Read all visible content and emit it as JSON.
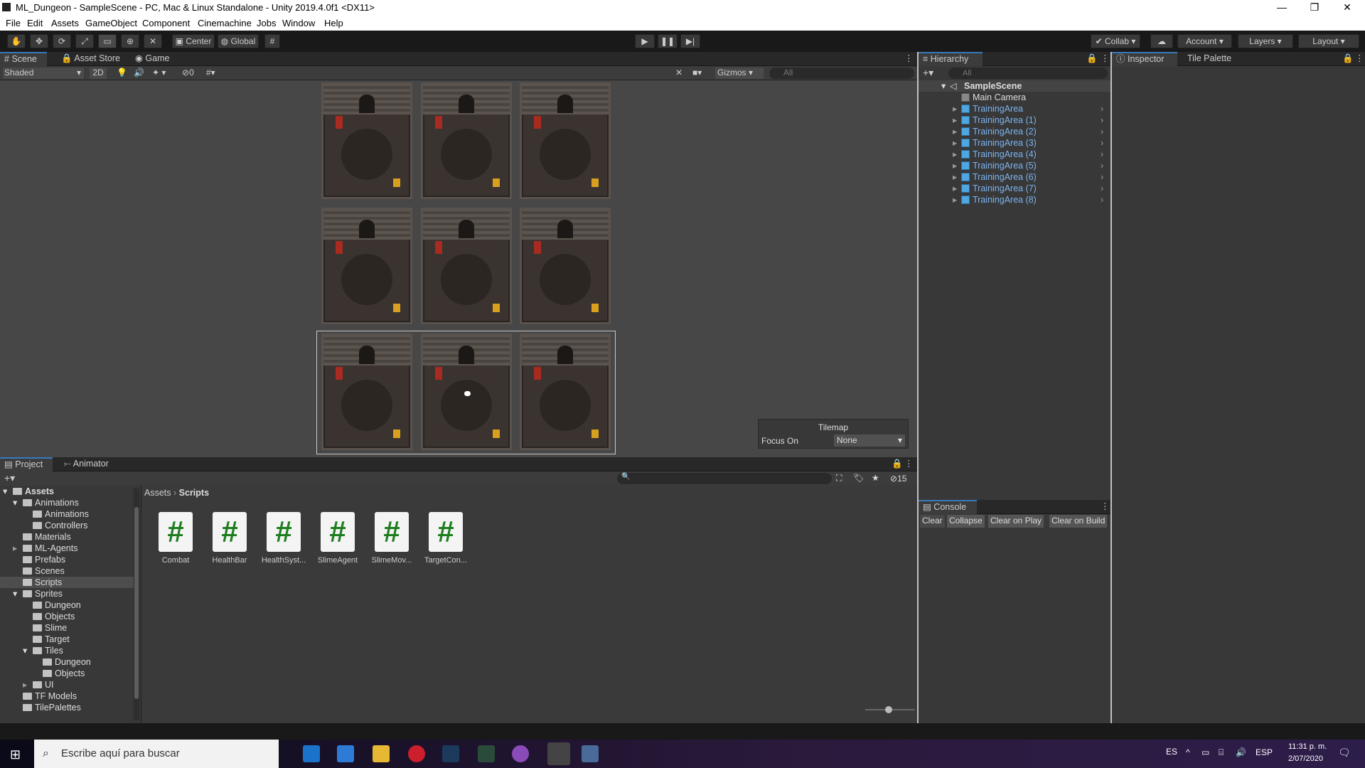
{
  "window": {
    "title": "ML_Dungeon - SampleScene - PC, Mac & Linux Standalone - Unity 2019.4.0f1 <DX11>",
    "minimize": "—",
    "maximize": "❐",
    "close": "✕"
  },
  "menu": [
    "File",
    "Edit",
    "Assets",
    "GameObject",
    "Component",
    "Cinemachine",
    "Jobs",
    "Window",
    "Help"
  ],
  "toolbar": {
    "center": "Center",
    "global": "Global",
    "collab": "Collab",
    "account": "Account",
    "layers": "Layers",
    "layout": "Layout"
  },
  "scene_tabs": {
    "scene": "Scene",
    "asset_store": "Asset Store",
    "game": "Game"
  },
  "scene_toolbar": {
    "shading": "Shaded",
    "mode_2d": "2D",
    "hidden_count": "0",
    "gizmos": "Gizmos",
    "search_placeholder": "All"
  },
  "tilemap_overlay": {
    "title": "Tilemap",
    "focus_label": "Focus On",
    "focus_value": "None"
  },
  "hierarchy": {
    "tab": "Hierarchy",
    "search_placeholder": "All",
    "scene": "SampleScene",
    "items": [
      "Main Camera",
      "TrainingArea",
      "TrainingArea (1)",
      "TrainingArea (2)",
      "TrainingArea (3)",
      "TrainingArea (4)",
      "TrainingArea (5)",
      "TrainingArea (6)",
      "TrainingArea (7)",
      "TrainingArea (8)"
    ]
  },
  "inspector": {
    "tab": "Inspector",
    "tile_palette": "Tile Palette"
  },
  "project": {
    "tabs": {
      "project": "Project",
      "animator": "Animator"
    },
    "hidden_count": "15",
    "breadcrumb": {
      "root": "Assets",
      "current": "Scripts"
    },
    "tree": [
      {
        "label": "Assets",
        "depth": 0,
        "bold": true,
        "arrow": "open"
      },
      {
        "label": "Animations",
        "depth": 1,
        "arrow": "open"
      },
      {
        "label": "Animations",
        "depth": 2
      },
      {
        "label": "Controllers",
        "depth": 2
      },
      {
        "label": "Materials",
        "depth": 1
      },
      {
        "label": "ML-Agents",
        "depth": 1,
        "arrow": "closed"
      },
      {
        "label": "Prefabs",
        "depth": 1
      },
      {
        "label": "Scenes",
        "depth": 1
      },
      {
        "label": "Scripts",
        "depth": 1,
        "selected": true
      },
      {
        "label": "Sprites",
        "depth": 1,
        "arrow": "open"
      },
      {
        "label": "Dungeon",
        "depth": 2
      },
      {
        "label": "Objects",
        "depth": 2
      },
      {
        "label": "Slime",
        "depth": 2
      },
      {
        "label": "Target",
        "depth": 2
      },
      {
        "label": "Tiles",
        "depth": 2,
        "arrow": "open"
      },
      {
        "label": "Dungeon",
        "depth": 3
      },
      {
        "label": "Objects",
        "depth": 3
      },
      {
        "label": "UI",
        "depth": 2,
        "arrow": "closed"
      },
      {
        "label": "TF Models",
        "depth": 1
      },
      {
        "label": "TilePalettes",
        "depth": 1
      }
    ],
    "assets": [
      "Combat",
      "HealthBar",
      "HealthSyst...",
      "SlimeAgent",
      "SlimeMov...",
      "TargetCon..."
    ]
  },
  "console": {
    "tab": "Console",
    "buttons": [
      "Clear",
      "Collapse",
      "Clear on Play",
      "Clear on Build"
    ]
  },
  "taskbar": {
    "search_placeholder": "Escribe aquí para buscar",
    "lang": "ES",
    "keyboard": "ESP",
    "time": "11:31 p. m.",
    "date": "2/07/2020"
  },
  "colors": {
    "accent": "#3a79bb",
    "hierarchy_prefab": "#7cb4f0",
    "script_icon": "#1e7e1e"
  }
}
